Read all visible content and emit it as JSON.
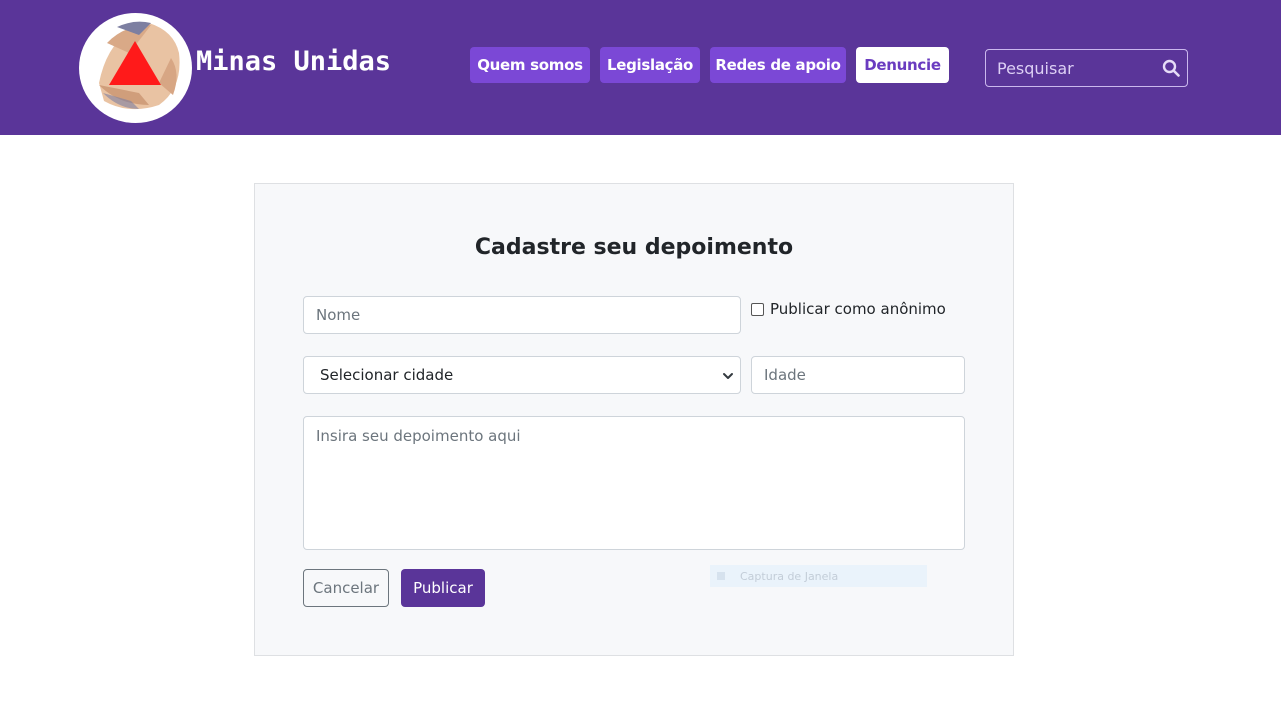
{
  "header": {
    "brand": "Minas Unidas",
    "nav": {
      "quem_somos": "Quem somos",
      "legislacao": "Legislação",
      "redes_de_apoio": "Redes de apoio",
      "denuncie": "Denuncie"
    },
    "search": {
      "placeholder": "Pesquisar",
      "icon": "search-icon"
    }
  },
  "form": {
    "title": "Cadastre seu depoimento",
    "nome_placeholder": "Nome",
    "anonimo_label": "Publicar como anônimo",
    "anonimo_checked": false,
    "cidade_selected": "Selecionar cidade",
    "idade_placeholder": "Idade",
    "depoimento_placeholder": "Insira seu depoimento aqui",
    "cancel_label": "Cancelar",
    "publish_label": "Publicar"
  },
  "overlay": {
    "capture_label": "Captura de Janela"
  },
  "colors": {
    "header_bg": "#5a3599",
    "nav_button": "#7b48d6",
    "denuncie_text": "#6a3cc0",
    "card_bg": "#f7f8fa",
    "logo_triangle": "#ff1a1a"
  }
}
